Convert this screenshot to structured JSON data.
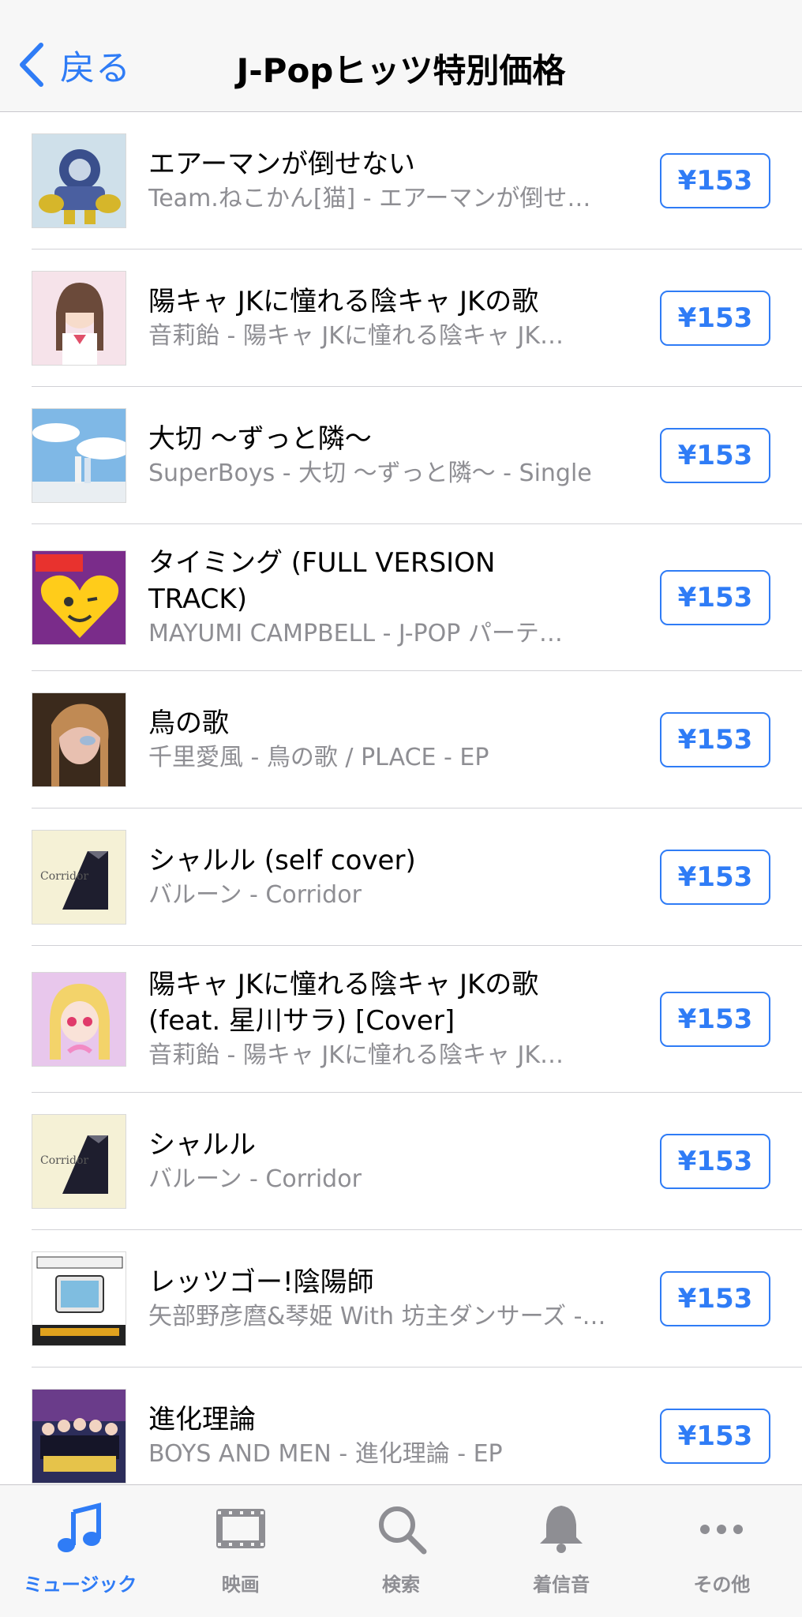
{
  "nav": {
    "back_label": "戻る",
    "title": "J-Popヒッツ特別価格"
  },
  "list": [
    {
      "title_lines": [
        "エアーマンが倒せない"
      ],
      "subtitle": "Team.ねこかん[猫] - エアーマンが倒せ…",
      "price": "¥153",
      "art": "robot"
    },
    {
      "title_lines": [
        "陽キャ JKに憧れる陰キャ JKの歌"
      ],
      "subtitle": "音莉飴 - 陽キャ JKに憧れる陰キャ JK…",
      "price": "¥153",
      "art": "girl-pink"
    },
    {
      "title_lines": [
        "大切 〜ずっと隣〜"
      ],
      "subtitle": "SuperBoys - 大切 〜ずっと隣〜 - Single",
      "price": "¥153",
      "art": "sky-couple"
    },
    {
      "title_lines": [
        "タイミング (FULL VERSION",
        "TRACK)"
      ],
      "subtitle": "MAYUMI CAMPBELL - J-POP パーテ…",
      "price": "¥153",
      "art": "jpop-party"
    },
    {
      "title_lines": [
        "鳥の歌"
      ],
      "subtitle": "千里愛風 - 鳥の歌 / PLACE - EP",
      "price": "¥153",
      "art": "portrait-dark"
    },
    {
      "title_lines": [
        "シャルル (self cover)"
      ],
      "subtitle": "バルーン - Corridor",
      "price": "¥153",
      "art": "corridor"
    },
    {
      "title_lines": [
        "陽キャ JKに憧れる陰キャ JKの歌",
        "(feat. 星川サラ) [Cover]"
      ],
      "subtitle": "音莉飴 - 陽キャ JKに憧れる陰キャ JK…",
      "price": "¥153",
      "art": "anime-blonde"
    },
    {
      "title_lines": [
        "シャルル"
      ],
      "subtitle": "バルーン - Corridor",
      "price": "¥153",
      "art": "corridor"
    },
    {
      "title_lines": [
        "レッツゴー!陰陽師"
      ],
      "subtitle": "矢部野彦麿&琴姫 With 坊主ダンサーズ -…",
      "price": "¥153",
      "art": "retro-tv"
    },
    {
      "title_lines": [
        "進化理論"
      ],
      "subtitle": "BOYS AND MEN - 進化理論 - EP",
      "price": "¥153",
      "art": "group-photo"
    }
  ],
  "tabbar": [
    {
      "label": "ミュージック",
      "icon": "music-note-icon",
      "active": true
    },
    {
      "label": "映画",
      "icon": "film-icon",
      "active": false
    },
    {
      "label": "検索",
      "icon": "search-icon",
      "active": false
    },
    {
      "label": "着信音",
      "icon": "bell-icon",
      "active": false
    },
    {
      "label": "その他",
      "icon": "more-icon",
      "active": false
    }
  ],
  "colors": {
    "accent": "#2f7cf6",
    "secondary_text": "#8e8e93"
  }
}
